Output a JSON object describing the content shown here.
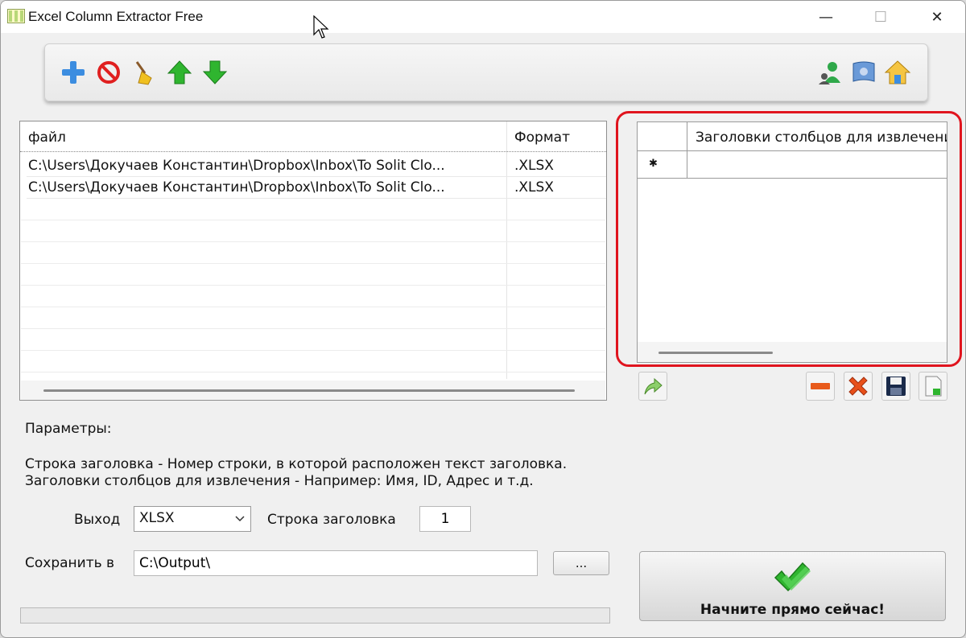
{
  "window": {
    "title": "Excel Column Extractor Free",
    "controls": {
      "minimize": "—",
      "maximize": "☐",
      "close": "✕"
    }
  },
  "toolbar": {
    "left_icons": [
      "add-icon",
      "remove-icon",
      "clear-broom-icon",
      "move-up-icon",
      "move-down-icon"
    ],
    "right_icons": [
      "user-account-icon",
      "flag-icon",
      "home-icon"
    ]
  },
  "file_table": {
    "columns": [
      "файл",
      "Формат"
    ],
    "rows": [
      {
        "file": "C:\\Users\\Докучаев Константин\\Dropbox\\Inbox\\To Solit Clo...",
        "format": ".XLSX"
      },
      {
        "file": "C:\\Users\\Докучаев Константин\\Dropbox\\Inbox\\To Solit Clo...",
        "format": ".XLSX"
      }
    ]
  },
  "columns_grid": {
    "header": "Заголовки столбцов для извлечения",
    "new_row_marker": "✱"
  },
  "grid_buttons": [
    "apply-arrow-icon",
    "delete-row-icon",
    "delete-all-icon",
    "save-icon",
    "export-icon"
  ],
  "params": {
    "heading": "Параметры:",
    "help_line1": "Строка заголовка - Номер строки, в которой расположен текст заголовка.",
    "help_line2": "Заголовки столбцов для извлечения - Например: Имя, ID, Адрес и т.д.",
    "output_label": "Выход",
    "output_value": "XLSX",
    "header_row_label": "Строка заголовка",
    "header_row_value": "1",
    "save_label": "Сохранить в",
    "save_path": "C:\\Output\\",
    "browse_label": "..."
  },
  "start_button": {
    "label": "Начните прямо сейчас!"
  },
  "colors": {
    "highlight": "#e0141e",
    "check_green": "#2fb52f"
  }
}
